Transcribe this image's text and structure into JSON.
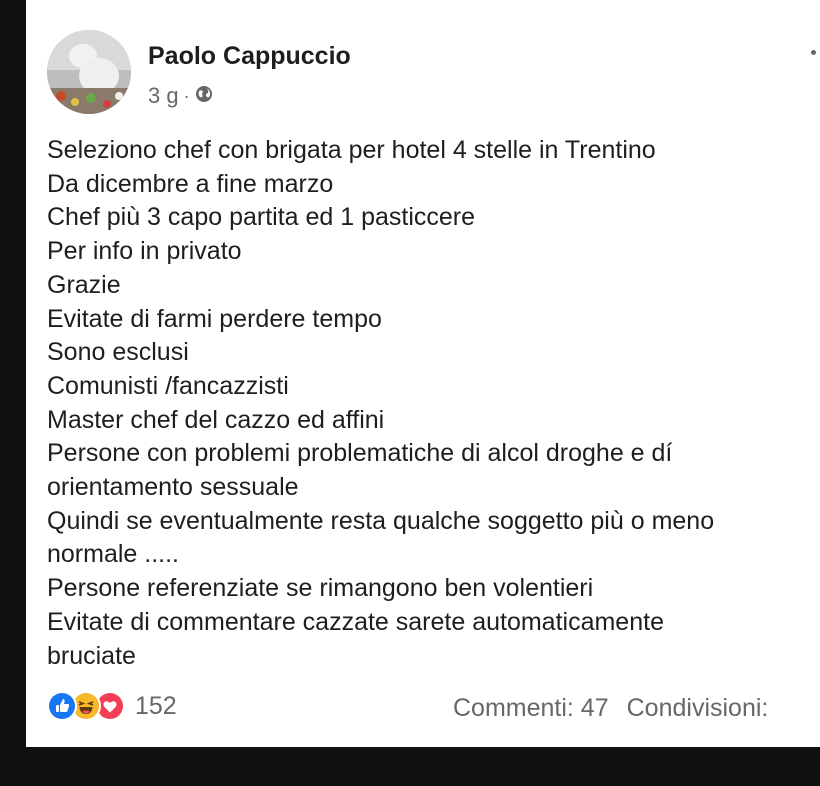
{
  "post": {
    "author": "Paolo Cappuccio",
    "time": "3 g",
    "separator": "·",
    "privacy_icon": "globe-icon",
    "lines": [
      "Seleziono chef con brigata per hotel 4 stelle in Trentino",
      "Da dicembre a fine marzo",
      "Chef più 3 capo partita ed 1 pasticcere",
      "Per info in privato",
      "Grazie",
      "Evitate di farmi perdere tempo",
      "Sono esclusi",
      "Comunisti /fancazzisti",
      "Master chef del cazzo ed affini",
      "Persone con problemi problematiche di alcol droghe e dí",
      "orientamento sessuale",
      "Quindi se eventualmente resta qualche soggetto più o meno",
      "normale .....",
      "Persone referenziate se rimangono ben volentieri",
      "Evitate di commentare cazzate sarete automaticamente",
      "bruciate"
    ]
  },
  "reactions": {
    "icons": [
      "like-icon",
      "haha-icon",
      "love-icon"
    ],
    "count": "152"
  },
  "stats": {
    "comments": "Commenti: 47",
    "shares": "Condivisioni:"
  },
  "colors": {
    "like": "#1877f2",
    "haha": "#f7b928",
    "love": "#f33e58"
  }
}
